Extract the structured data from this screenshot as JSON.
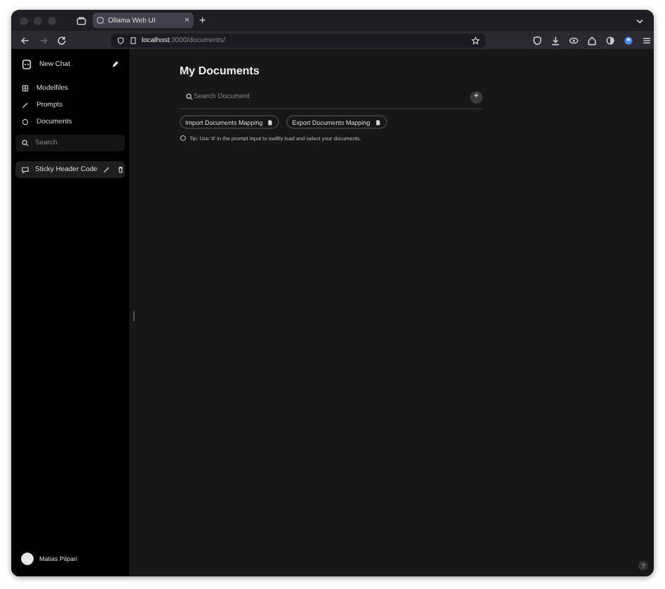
{
  "browser": {
    "tab": {
      "title": "Ollama Web UI",
      "close": "×",
      "selected": true
    },
    "new_tab": "+",
    "url": {
      "host": "localhost",
      "path": ":3000/documents/"
    }
  },
  "sidebar": {
    "new_chat": "New Chat",
    "nav": [
      {
        "label": "Modelfiles",
        "kind": "modelfiles"
      },
      {
        "label": "Prompts",
        "kind": "prompts"
      },
      {
        "label": "Documents",
        "kind": "documents"
      }
    ],
    "search": {
      "placeholder": "Search"
    },
    "chats": [
      {
        "title": "Sticky Header Code",
        "selected": true
      }
    ],
    "user": {
      "name": "Matias Pilpari"
    }
  },
  "main": {
    "title": "My Documents",
    "search": {
      "placeholder": "Search Document"
    },
    "add": "+",
    "buttons": [
      "Import Documents Mapping",
      "Export Documents Mapping"
    ],
    "tip": "Tip: Use '#' in the prompt input to swiftly load and select your documents."
  },
  "help": "?"
}
